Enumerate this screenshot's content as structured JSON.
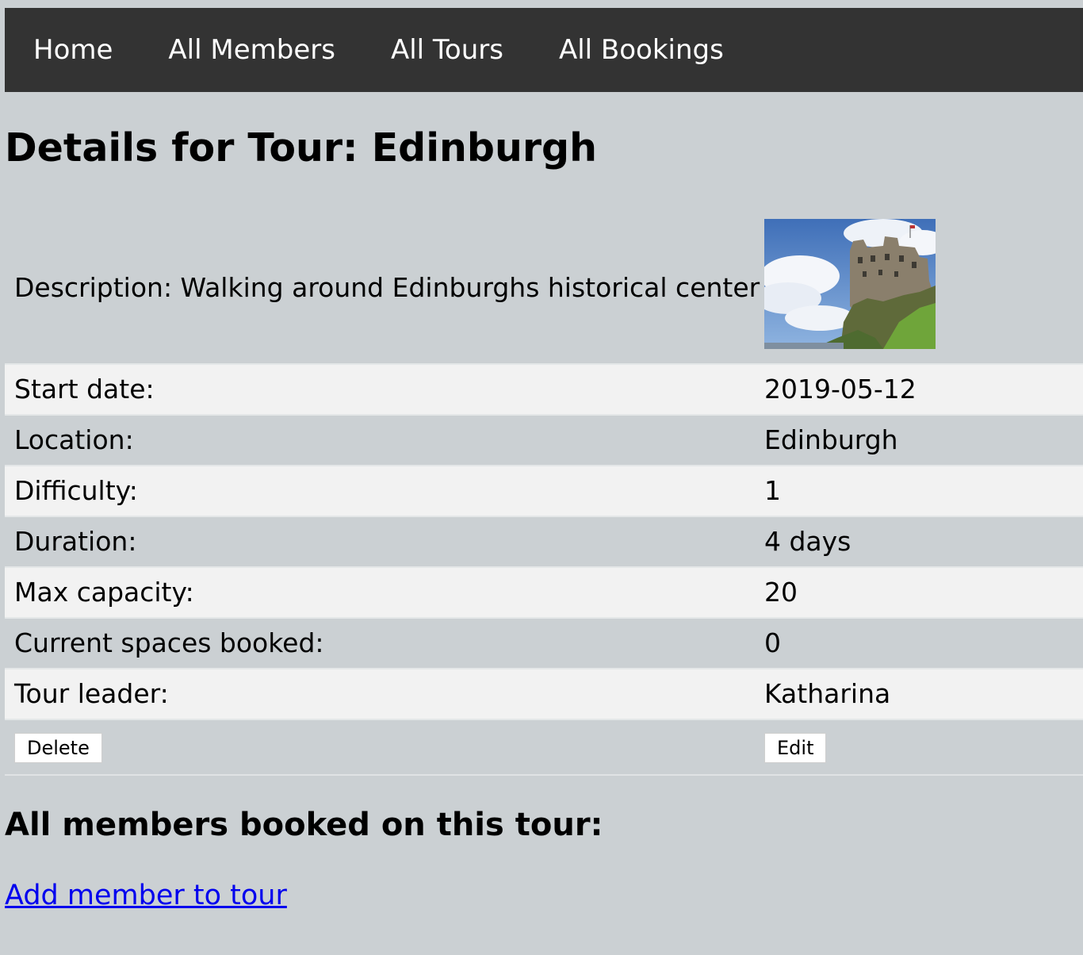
{
  "nav": {
    "items": [
      "Home",
      "All Members",
      "All Tours",
      "All Bookings"
    ]
  },
  "page_title": "Details for Tour: Edinburgh",
  "tour": {
    "description_label": "Description: Walking around Edinburghs historical center",
    "image_name": "edinburgh-castle-image",
    "fields": [
      {
        "label": "Start date:",
        "value": "2019-05-12"
      },
      {
        "label": "Location:",
        "value": "Edinburgh"
      },
      {
        "label": "Difficulty:",
        "value": "1"
      },
      {
        "label": "Duration:",
        "value": "4 days"
      },
      {
        "label": "Max capacity:",
        "value": "20"
      },
      {
        "label": "Current spaces booked:",
        "value": "0"
      },
      {
        "label": "Tour leader:",
        "value": "Katharina"
      }
    ]
  },
  "actions": {
    "delete_label": "Delete",
    "edit_label": "Edit"
  },
  "members": {
    "heading": "All members booked on this tour:",
    "add_link": "Add member to tour"
  },
  "colors": {
    "background": "#cbd0d3",
    "navbar": "#333333",
    "row_light": "#f2f2f2",
    "link": "#0000ee"
  }
}
